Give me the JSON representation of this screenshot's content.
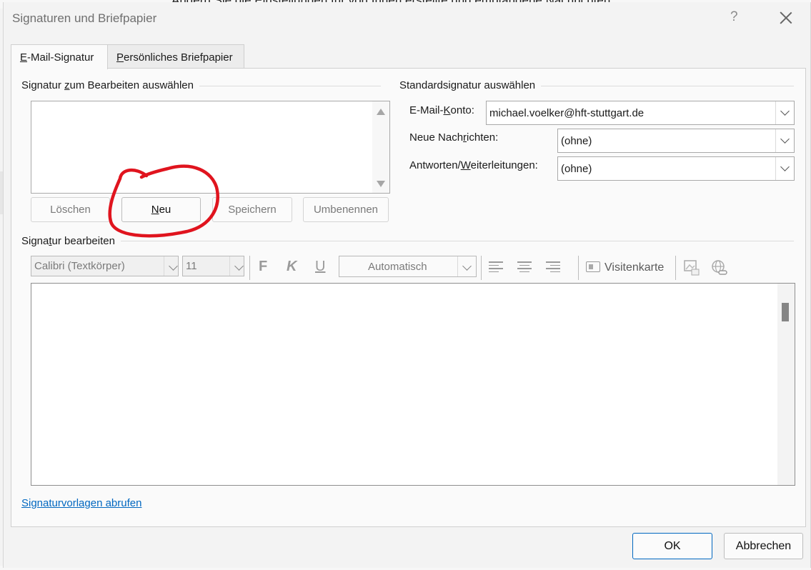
{
  "background": {
    "partial_text": "Ändern Sie die Einstellungen für von Ihnen erstellte und empfangene Nachrichten."
  },
  "dialog": {
    "title": "Signaturen und Briefpapier",
    "help_label": "?"
  },
  "tabs": [
    {
      "label": "E-Mail-Signatur",
      "accesskey": "E",
      "rest": "-Mail-Signatur",
      "active": true
    },
    {
      "label": "Persönliches Briefpapier",
      "accesskey": "P",
      "rest": "ersönliches Briefpapier",
      "active": false
    }
  ],
  "select_group": {
    "label_pre": "Signatur ",
    "label_key": "z",
    "label_post": "um Bearbeiten auswählen",
    "signatures": []
  },
  "buttons": {
    "delete": "Löschen",
    "new_key": "N",
    "new_rest": "eu",
    "save": "Speichern",
    "rename": "Umbenennen"
  },
  "default_group": {
    "label": "Standardsignatur auswählen",
    "account_label_pre": "E-Mail-",
    "account_label_key": "K",
    "account_label_post": "onto:",
    "account_value": "michael.voelker@hft-stuttgart.de",
    "new_msg_label_pre": "Neue Nach",
    "new_msg_label_key": "r",
    "new_msg_label_post": "ichten:",
    "new_msg_value": "(ohne)",
    "reply_label_pre": "Antworten/",
    "reply_label_key": "W",
    "reply_label_post": "eiterleitungen:",
    "reply_value": "(ohne)"
  },
  "edit_group": {
    "label_pre": "Signa",
    "label_key": "t",
    "label_post": "ur bearbeiten",
    "font": "Calibri (Textkörper)",
    "size": "11",
    "bold": "F",
    "italic": "K",
    "underline": "U",
    "color": "Automatisch",
    "business_card": "Visitenkarte",
    "content": ""
  },
  "link_text": "Signaturvorlagen abrufen",
  "footer": {
    "ok": "OK",
    "cancel": "Abbrechen"
  },
  "annotation": {
    "color": "#e0141e",
    "target": "new-button"
  }
}
